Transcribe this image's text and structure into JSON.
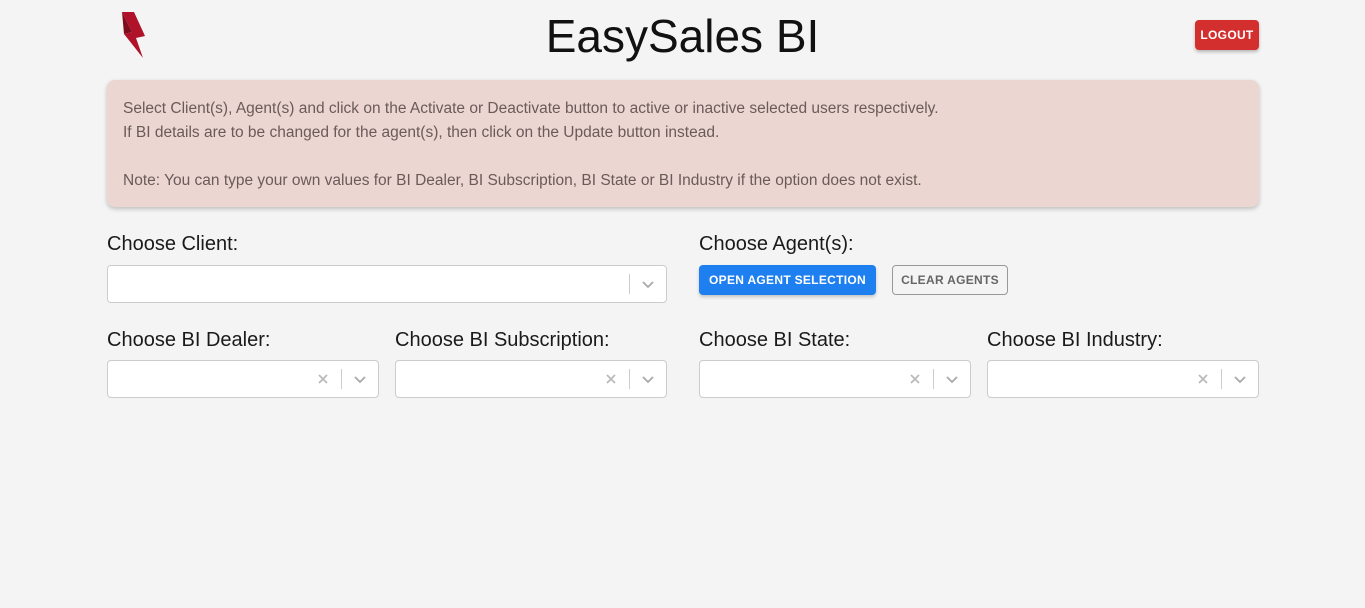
{
  "header": {
    "title": "EasySales BI",
    "logo_icon": "lightning-bolt-icon",
    "logout_label": "LOGOUT"
  },
  "info": {
    "line1": "Select Client(s), Agent(s) and click on the Activate or Deactivate button to active or inactive selected users respectively.",
    "line2": "If BI details are to be changed for the agent(s), then click on the Update button instead.",
    "note": "Note: You can type your own values for BI Dealer, BI Subscription, BI State or BI Industry if the option does not exist."
  },
  "client": {
    "label": "Choose Client:",
    "value": ""
  },
  "agents": {
    "label": "Choose Agent(s):",
    "open_label": "OPEN AGENT SELECTION",
    "clear_label": "CLEAR AGENTS"
  },
  "bi_dealer": {
    "label": "Choose BI Dealer:",
    "value": ""
  },
  "bi_subscription": {
    "label": "Choose BI Subscription:",
    "value": ""
  },
  "bi_state": {
    "label": "Choose BI State:",
    "value": ""
  },
  "bi_industry": {
    "label": "Choose BI Industry:",
    "value": ""
  },
  "colors": {
    "background": "#f4f4f4",
    "logout": "#d32f2f",
    "primary": "#1e7ff0",
    "info_box": "#ebd6d2",
    "logo": "#b0122a"
  }
}
